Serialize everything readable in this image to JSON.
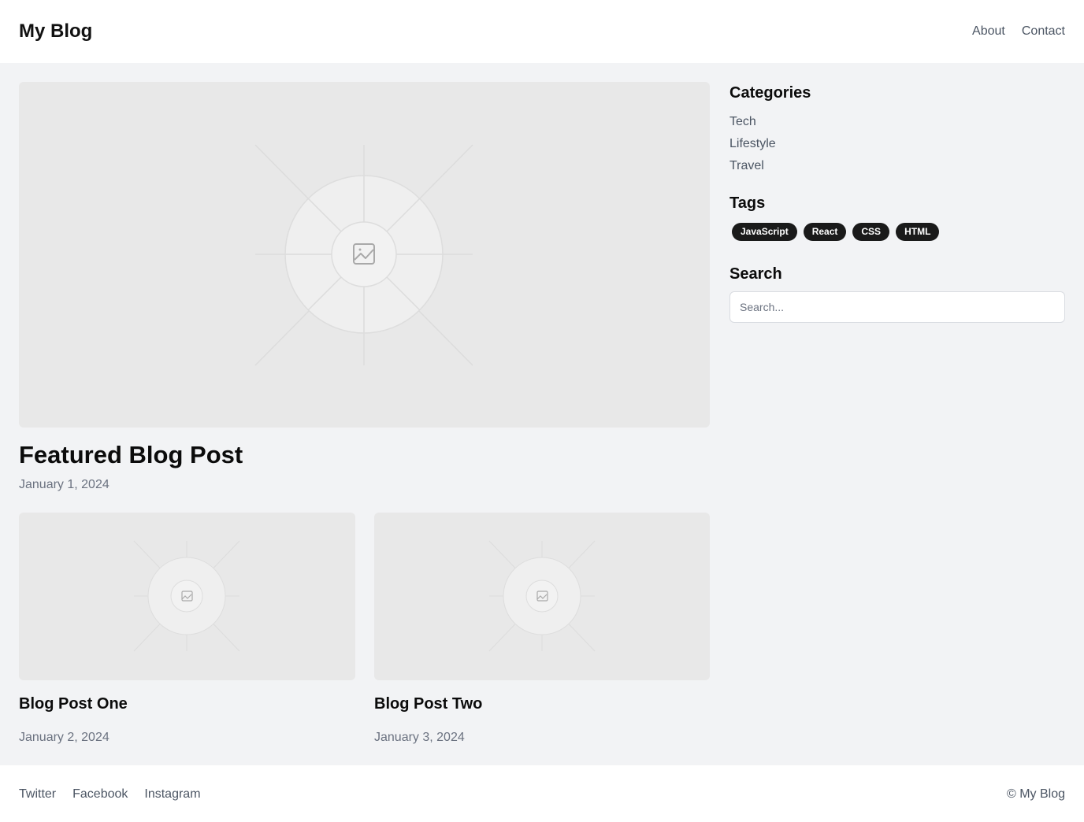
{
  "header": {
    "logo": "My Blog",
    "nav": [
      "About",
      "Contact"
    ]
  },
  "featured": {
    "title": "Featured Blog Post",
    "date": "January 1, 2024",
    "image_icon": "image-placeholder-icon"
  },
  "posts": [
    {
      "title": "Blog Post One",
      "date": "January 2, 2024",
      "image_icon": "image-placeholder-icon"
    },
    {
      "title": "Blog Post Two",
      "date": "January 3, 2024",
      "image_icon": "image-placeholder-icon"
    }
  ],
  "sidebar": {
    "categories_heading": "Categories",
    "categories": [
      "Tech",
      "Lifestyle",
      "Travel"
    ],
    "tags_heading": "Tags",
    "tags": [
      "JavaScript",
      "React",
      "CSS",
      "HTML"
    ],
    "search_heading": "Search",
    "search_placeholder": "Search...",
    "search_value": ""
  },
  "footer": {
    "social": [
      "Twitter",
      "Facebook",
      "Instagram"
    ],
    "copyright": "© My Blog"
  },
  "colors": {
    "page_bg": "#f2f3f5",
    "surface": "#ffffff",
    "placeholder_bg": "#e8e8e8",
    "tag_bg": "#1a1a1a",
    "muted_text": "#6b7280"
  }
}
